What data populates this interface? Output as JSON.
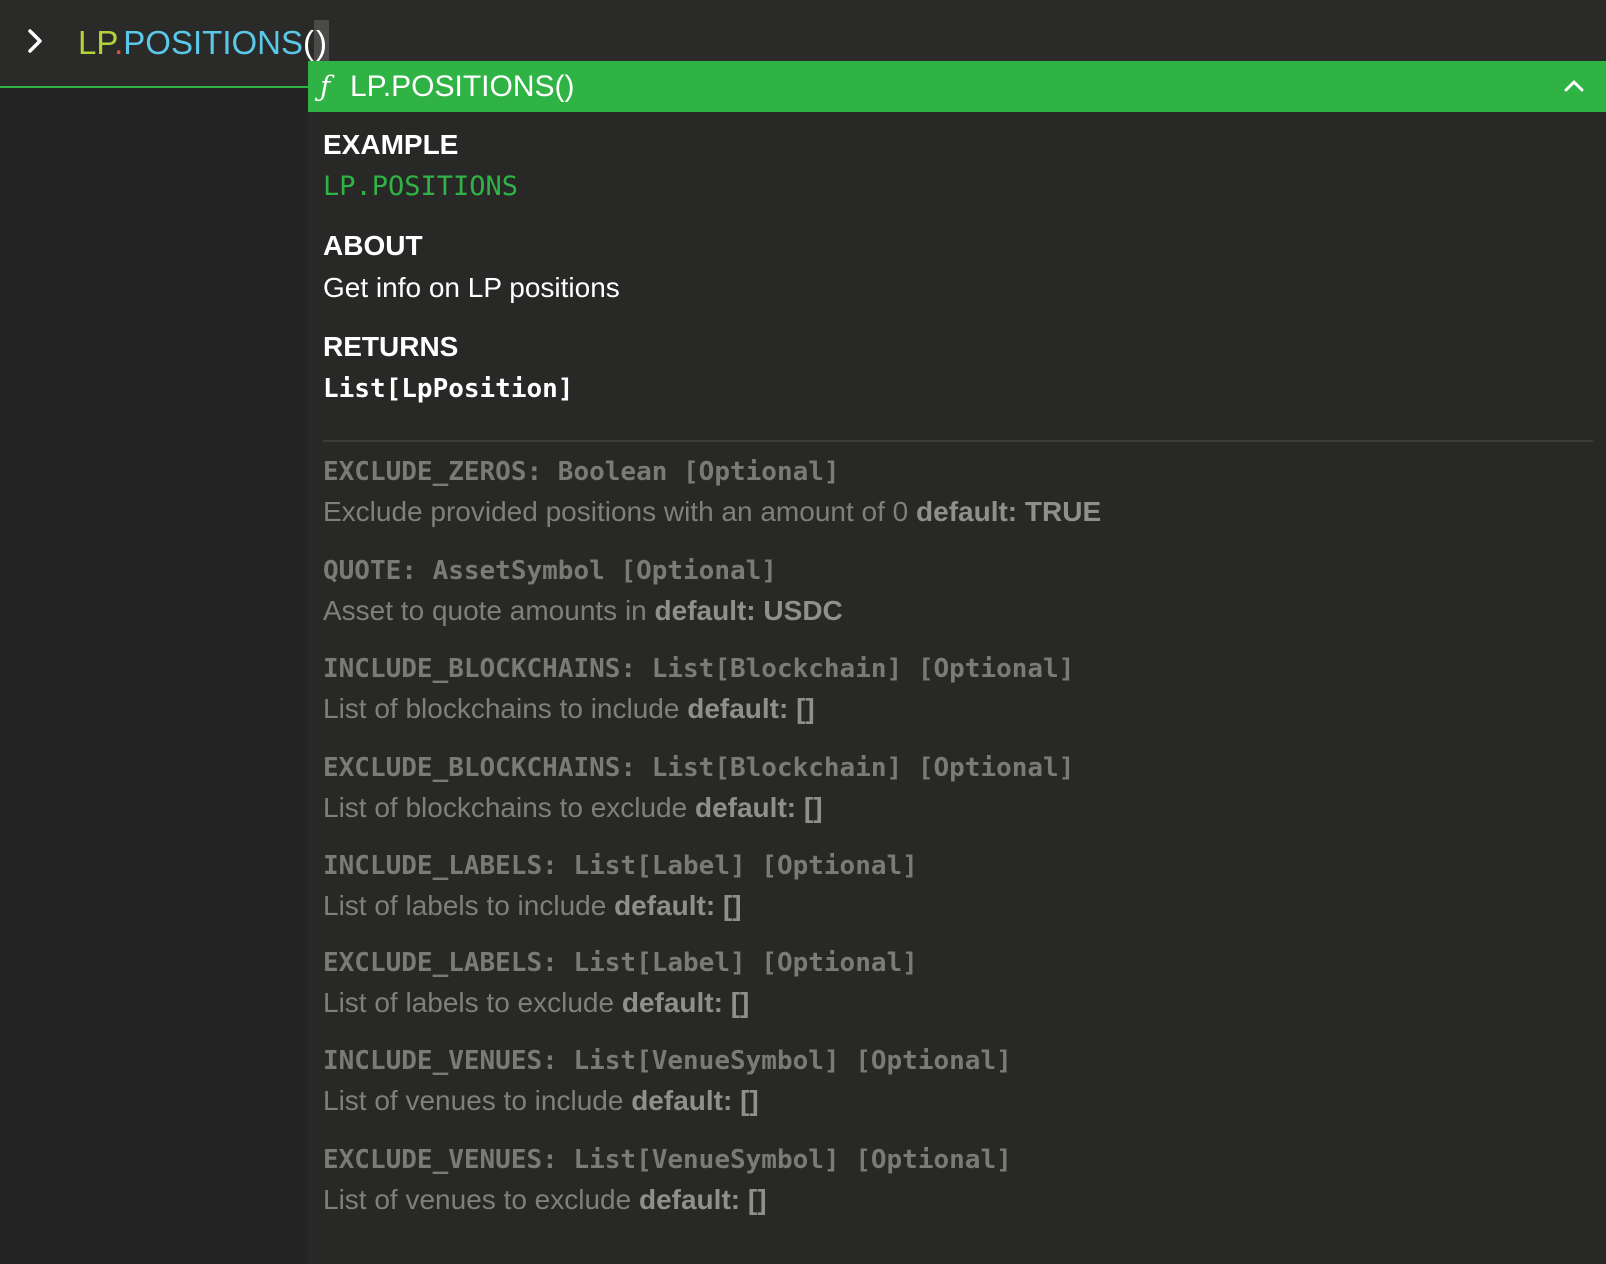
{
  "command": {
    "namespace": "LP",
    "dot": ".",
    "function": "POSITIONS",
    "open_paren": "(",
    "close_paren": ")",
    "prompt_icon": "chevron-right-icon"
  },
  "doc": {
    "function_icon": "ƒ",
    "title": "LP.POSITIONS()",
    "collapse_icon": "chevron-up-icon",
    "example_heading": "EXAMPLE",
    "example_code": "LP.POSITIONS",
    "about_heading": "ABOUT",
    "about_text": "Get info on LP positions",
    "returns_heading": "RETURNS",
    "returns_type": "List[LpPosition]",
    "params": [
      {
        "signature": "EXCLUDE_ZEROS: Boolean [Optional]",
        "description": "Exclude provided positions with an amount of 0 ",
        "default_label": "default:",
        "default_value": "TRUE"
      },
      {
        "signature": "QUOTE: AssetSymbol [Optional]",
        "description": "Asset to quote amounts in ",
        "default_label": "default:",
        "default_value": "USDC"
      },
      {
        "signature": "INCLUDE_BLOCKCHAINS: List[Blockchain] [Optional]",
        "description": "List of blockchains to include ",
        "default_label": "default:",
        "default_value": "[]"
      },
      {
        "signature": "EXCLUDE_BLOCKCHAINS: List[Blockchain] [Optional]",
        "description": "List of blockchains to exclude ",
        "default_label": "default:",
        "default_value": "[]"
      },
      {
        "signature": "INCLUDE_LABELS: List[Label] [Optional]",
        "description": "List of labels to include ",
        "default_label": "default:",
        "default_value": "[]"
      },
      {
        "signature": "EXCLUDE_LABELS: List[Label] [Optional]",
        "description": "List of labels to exclude ",
        "default_label": "default:",
        "default_value": "[]"
      },
      {
        "signature": "INCLUDE_VENUES: List[VenueSymbol] [Optional]",
        "description": "List of venues to include ",
        "default_label": "default:",
        "default_value": "[]"
      },
      {
        "signature": "EXCLUDE_VENUES: List[VenueSymbol] [Optional]",
        "description": "List of venues to exclude ",
        "default_label": "default:",
        "default_value": "[]"
      }
    ]
  },
  "colors": {
    "accent_green": "#2fb344",
    "namespace_yellow": "#b4d23b",
    "dot_red": "#e0533a",
    "function_blue": "#5bc8e8",
    "background": "#242424",
    "panel_background": "#282927"
  }
}
